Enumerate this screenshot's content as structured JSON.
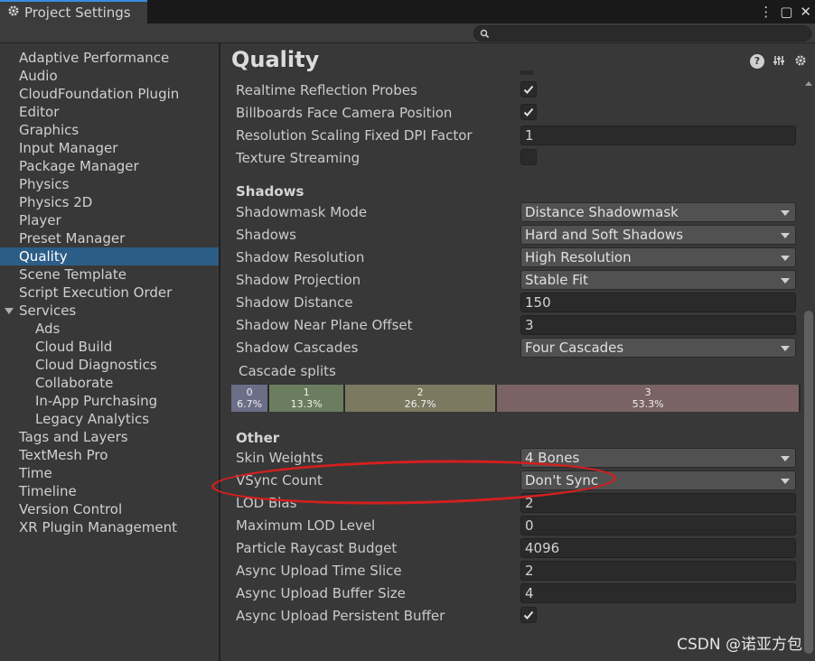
{
  "window": {
    "tab_title": "Project Settings",
    "icons": [
      "gear-icon",
      "more-icon",
      "maximize-icon",
      "close-icon"
    ],
    "controls": {
      "more": "⋮",
      "maximize": "▢",
      "close": "✕"
    }
  },
  "search": {
    "placeholder": "",
    "icon": "search-icon"
  },
  "sidebar": {
    "items": [
      "Adaptive Performance",
      "Audio",
      "CloudFoundation Plugin",
      "Editor",
      "Graphics",
      "Input Manager",
      "Package Manager",
      "Physics",
      "Physics 2D",
      "Player",
      "Preset Manager",
      "Quality",
      "Scene Template",
      "Script Execution Order",
      "Services",
      "Ads",
      "Cloud Build",
      "Cloud Diagnostics",
      "Collaborate",
      "In-App Purchasing",
      "Legacy Analytics",
      "Tags and Layers",
      "TextMesh Pro",
      "Time",
      "Timeline",
      "Version Control",
      "XR Plugin Management"
    ],
    "selected": "Quality",
    "expanded_group": "Services"
  },
  "main": {
    "title": "Quality",
    "header_icons": [
      "help-icon",
      "preset-icon",
      "settings-gear-icon"
    ],
    "rendering": {
      "realtime_reflection_probes": {
        "label": "Realtime Reflection Probes",
        "checked": true
      },
      "billboards_face_camera": {
        "label": "Billboards Face Camera Position",
        "checked": true
      },
      "resolution_scaling_dpi": {
        "label": "Resolution Scaling Fixed DPI Factor",
        "value": "1"
      },
      "texture_streaming": {
        "label": "Texture Streaming",
        "checked": false
      }
    },
    "shadows": {
      "section_title": "Shadows",
      "shadowmask_mode": {
        "label": "Shadowmask Mode",
        "value": "Distance Shadowmask"
      },
      "shadows": {
        "label": "Shadows",
        "value": "Hard and Soft Shadows"
      },
      "shadow_resolution": {
        "label": "Shadow Resolution",
        "value": "High Resolution"
      },
      "shadow_projection": {
        "label": "Shadow Projection",
        "value": "Stable Fit"
      },
      "shadow_distance": {
        "label": "Shadow Distance",
        "value": "150"
      },
      "shadow_near_plane_offset": {
        "label": "Shadow Near Plane Offset",
        "value": "3"
      },
      "shadow_cascades": {
        "label": "Shadow Cascades",
        "value": "Four Cascades"
      },
      "cascade_splits_label": "Cascade splits",
      "cascade_splits": [
        {
          "index": "0",
          "percent": "6.7%",
          "fraction": 0.067,
          "color": "#6c6e87"
        },
        {
          "index": "1",
          "percent": "13.3%",
          "fraction": 0.133,
          "color": "#6b7d5f"
        },
        {
          "index": "2",
          "percent": "26.7%",
          "fraction": 0.267,
          "color": "#7b7a61"
        },
        {
          "index": "3",
          "percent": "53.3%",
          "fraction": 0.533,
          "color": "#7a6362"
        }
      ]
    },
    "other": {
      "section_title": "Other",
      "skin_weights": {
        "label": "Skin Weights",
        "value": "4 Bones"
      },
      "vsync_count": {
        "label": "VSync Count",
        "value": "Don't Sync"
      },
      "lod_bias": {
        "label": "LOD Bias",
        "value": "2"
      },
      "maximum_lod_level": {
        "label": "Maximum LOD Level",
        "value": "0"
      },
      "particle_raycast_budget": {
        "label": "Particle Raycast Budget",
        "value": "4096"
      },
      "async_upload_time_slice": {
        "label": "Async Upload Time Slice",
        "value": "2"
      },
      "async_upload_buffer_size": {
        "label": "Async Upload Buffer Size",
        "value": "4"
      },
      "async_upload_persistent_buffer": {
        "label": "Async Upload Persistent Buffer",
        "checked": true
      }
    }
  },
  "annotation": {
    "highlight_color": "#d41f1f",
    "highlighted_setting": "VSync Count"
  },
  "watermark": "CSDN @诺亚方包",
  "colors": {
    "selection": "#2c5d87",
    "panel": "#383838",
    "accent_tab": "#3a8be0"
  }
}
